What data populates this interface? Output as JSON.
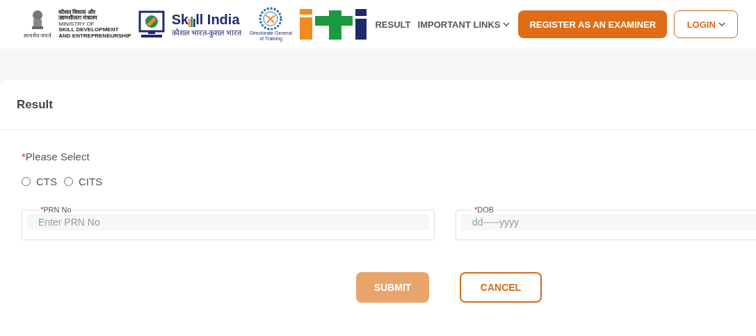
{
  "header": {
    "ministry_logo": {
      "hindi_lines": [
        "कौशल विकास और",
        "उद्यमशीलता मंत्रालय"
      ],
      "lines": [
        "MINISTRY OF",
        "SKILL DEVELOPMENT",
        "AND ENTREPRENEURSHIP"
      ],
      "motto": "सत्यमेव जयते"
    },
    "skill_india_logo": {
      "title_start": "Sk",
      "title_end": "ll India",
      "tagline": "कौशल भारत-कुशल भारत"
    },
    "dgt_logo": {
      "caption": "Directorate General of Training"
    },
    "nav": [
      {
        "label": "RESULT",
        "dropdown": false
      },
      {
        "label": "IMPORTANT LINKS",
        "dropdown": true
      }
    ],
    "register_button": "REGISTER AS AN EXAMINER",
    "login_button": {
      "label": "LOGIN",
      "dropdown": true
    }
  },
  "form": {
    "title": "Result",
    "required_mark": "*",
    "select_label": "Please Select",
    "options": [
      {
        "label": "CTS",
        "selected": false
      },
      {
        "label": "CITS",
        "selected": false
      }
    ],
    "fields": [
      {
        "label": "PRN No",
        "placeholder": "Enter PRN No"
      },
      {
        "label": "DOB",
        "placeholder": "dd-----yyyy"
      }
    ],
    "submit": {
      "label": "SUBMIT",
      "disabled": true
    },
    "cancel": "CANCEL"
  }
}
